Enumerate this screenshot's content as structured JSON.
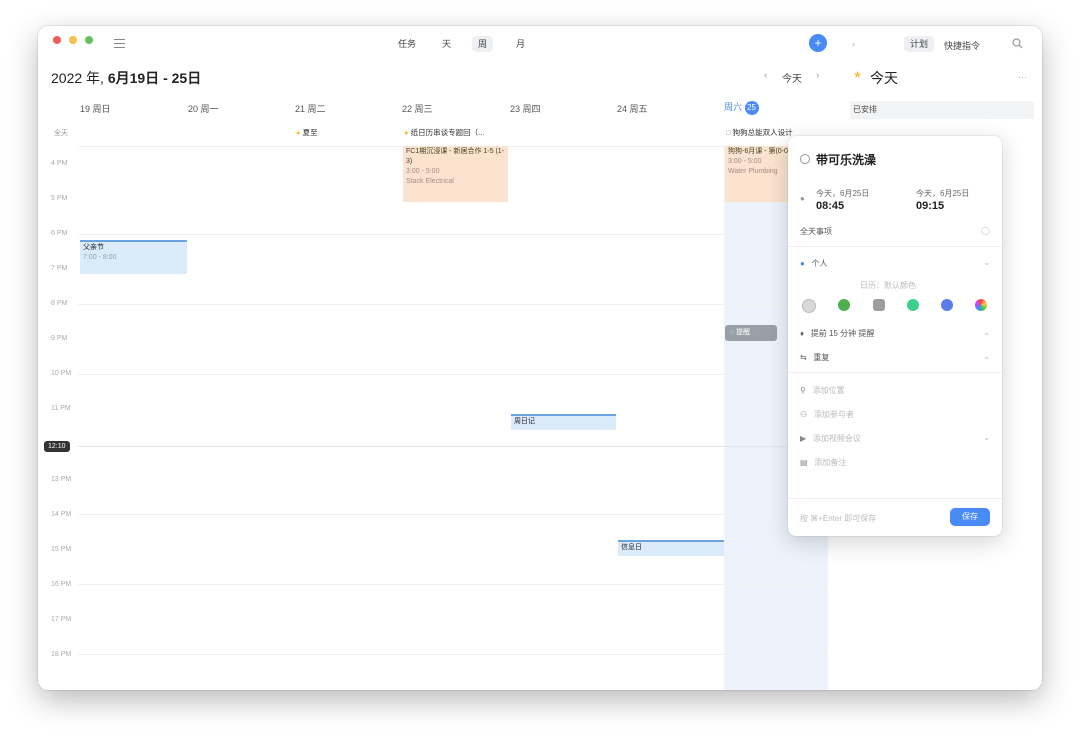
{
  "toolbar": {
    "views": [
      "任务",
      "天",
      "周",
      "月"
    ],
    "active_view": "周",
    "add_label": "+",
    "plan_label": "计划",
    "shortcut_label": "快捷指令"
  },
  "title": {
    "year": "2022 年,",
    "range": "6月19日 - 25日"
  },
  "nav": {
    "prev": "‹",
    "today": "今天",
    "next": "›"
  },
  "days": [
    {
      "num": "19",
      "name": "周日"
    },
    {
      "num": "20",
      "name": "周一"
    },
    {
      "num": "21",
      "name": "周二"
    },
    {
      "num": "22",
      "name": "周三"
    },
    {
      "num": "23",
      "name": "周四"
    },
    {
      "num": "24",
      "name": "周五"
    },
    {
      "name": "周六",
      "num": "25"
    }
  ],
  "allday": {
    "label": "全天",
    "events": [
      "夏至",
      "纸日历串谈专题回（...",
      "狗狗总能双人设计"
    ]
  },
  "time_labels": [
    "4 PM",
    "5 PM",
    "6 PM",
    "7 PM",
    "8 PM",
    "9 PM",
    "10 PM",
    "11 PM",
    "",
    "13 PM",
    "14 PM",
    "15 PM",
    "16 PM",
    "17 PM",
    "18 PM"
  ],
  "now_label": "12:10",
  "events": {
    "fathers_day": {
      "title": "父亲节",
      "sub": "7:00 - 8:00"
    },
    "fc": {
      "title": "FC1期沉浸课 - 新居合作 1-5 (1-3)",
      "sub": "3:00 - 5:00",
      "sub2": "Stack Electrical"
    },
    "thursday": {
      "title": "周日记"
    },
    "friday": {
      "title": "信息日"
    },
    "saturday": {
      "title": "狗狗-6月课 - 第(0-0)",
      "sub": "3:00 - 5:00",
      "sub2": "Water Plumbing"
    },
    "mini": {
      "title": "提醒"
    }
  },
  "right_panel": {
    "title": "今天",
    "section": "已安排"
  },
  "popup": {
    "title": "带可乐洗澡",
    "start_label": "今天，6月25日",
    "start_time": "08:45",
    "end_label": "今天，6月25日",
    "end_time": "09:15",
    "allday_label": "全天事项",
    "calendar": "个人",
    "color_hint": "日历：默认颜色",
    "reminder": "提前 15 分钟 提醒",
    "repeat": "重复",
    "location": "添加位置",
    "invitees": "添加参与者",
    "video": "添加视频会议",
    "notes": "添加备注",
    "footer_hint": "按 ⌘+Enter 即可保存",
    "save": "保存"
  },
  "colors": {
    "accent": "#4a8af4",
    "event_blue": "#dcebf9",
    "event_orange": "#fbe3cf"
  }
}
